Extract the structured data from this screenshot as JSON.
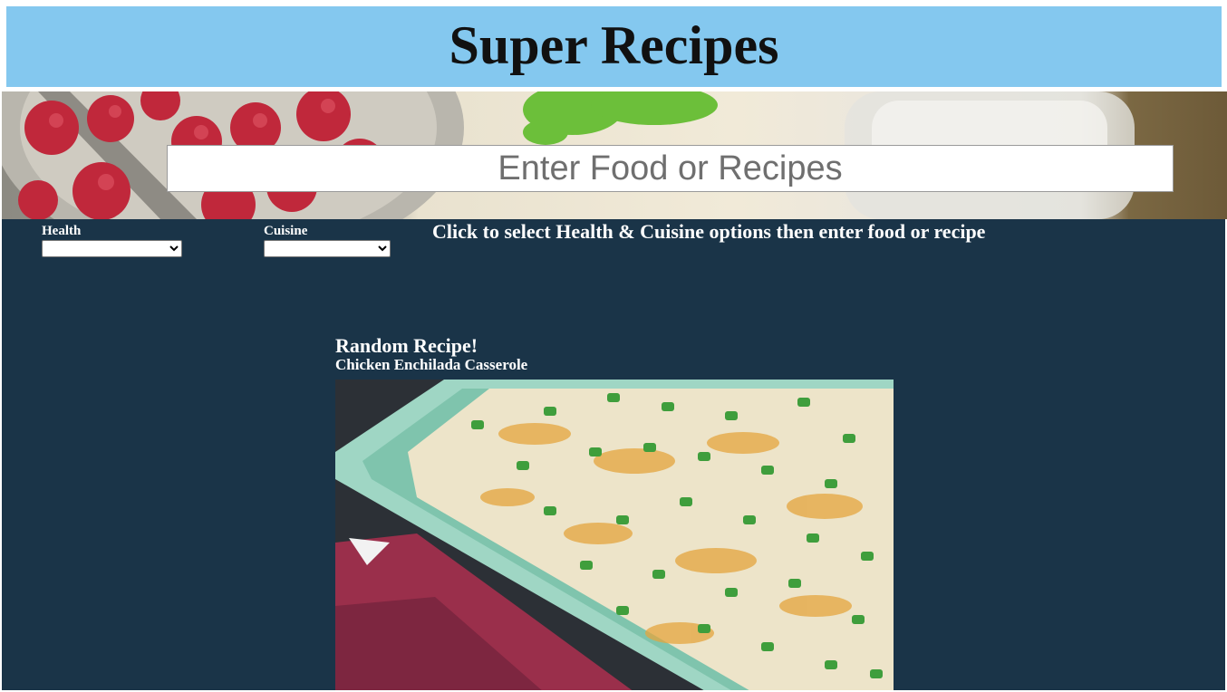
{
  "header": {
    "title": "Super Recipes"
  },
  "search": {
    "placeholder": "Enter Food or Recipes"
  },
  "filters": {
    "health_label": "Health",
    "health_selected": "",
    "cuisine_label": "Cuisine",
    "cuisine_selected": ""
  },
  "instructions": "Click to select Health & Cuisine options then enter food or recipe",
  "random_recipe": {
    "heading": "Random Recipe!",
    "name": "Chicken Enchilada Casserole"
  },
  "colors": {
    "header_bg": "#84c8ef",
    "main_bg": "#1a3448"
  }
}
